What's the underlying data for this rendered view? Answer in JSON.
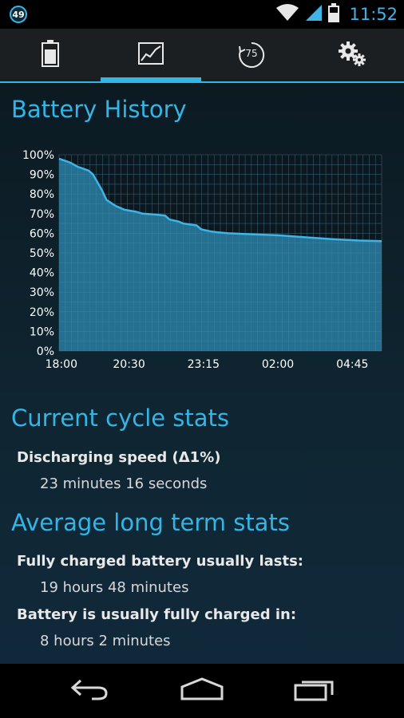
{
  "status_bar": {
    "notification_badge": "49",
    "time": "11:52",
    "icons": [
      "wifi-icon",
      "signal-icon",
      "battery-status-icon"
    ]
  },
  "tabs": [
    {
      "name": "battery",
      "icon": "battery-icon",
      "active": false
    },
    {
      "name": "history",
      "icon": "chart-icon",
      "active": true
    },
    {
      "name": "cycles",
      "icon": "cycle-counter-icon",
      "label": "75",
      "active": false
    },
    {
      "name": "settings",
      "icon": "gears-icon",
      "active": false
    }
  ],
  "history": {
    "title": "Battery History"
  },
  "current_cycle": {
    "title": "Current cycle stats",
    "discharging_label": "Discharging speed (Δ1%)",
    "discharging_value": "23 minutes 16 seconds"
  },
  "long_term": {
    "title": "Average long term stats",
    "lasts_label": "Fully charged battery usually lasts:",
    "lasts_value": "19 hours 48 minutes",
    "charged_label": "Battery is usually fully charged in:",
    "charged_value": "8 hours 2 minutes"
  },
  "nav_bar": {
    "icons": [
      "back-icon",
      "home-icon",
      "recent-apps-icon"
    ]
  },
  "colors": {
    "accent": "#33b5e5",
    "chart_fill": "#2a7fa4",
    "chart_line": "#3fb4e6"
  },
  "chart_data": {
    "type": "area",
    "title": "",
    "xlabel": "",
    "ylabel": "",
    "x_ticks": [
      "18:00",
      "20:30",
      "23:15",
      "02:00",
      "04:45"
    ],
    "y_ticks": [
      "0%",
      "10%",
      "20%",
      "30%",
      "40%",
      "50%",
      "60%",
      "70%",
      "80%",
      "90%",
      "100%"
    ],
    "ylim": [
      0,
      100
    ],
    "grid": true,
    "series": [
      {
        "points": [
          [
            "17:55",
            98
          ],
          [
            "18:20",
            96
          ],
          [
            "18:35",
            94
          ],
          [
            "19:00",
            92
          ],
          [
            "19:10",
            90
          ],
          [
            "19:30",
            82
          ],
          [
            "19:40",
            77
          ],
          [
            "20:00",
            74
          ],
          [
            "20:20",
            72
          ],
          [
            "20:45",
            71
          ],
          [
            "21:00",
            70
          ],
          [
            "21:30",
            69.5
          ],
          [
            "21:50",
            69
          ],
          [
            "22:00",
            67
          ],
          [
            "22:20",
            66
          ],
          [
            "22:30",
            65
          ],
          [
            "23:00",
            64
          ],
          [
            "23:10",
            62
          ],
          [
            "23:30",
            61
          ],
          [
            "23:45",
            60.5
          ],
          [
            "00:10",
            60
          ],
          [
            "01:00",
            59.5
          ],
          [
            "02:00",
            59
          ],
          [
            "03:00",
            58
          ],
          [
            "04:00",
            57
          ],
          [
            "05:00",
            56.3
          ],
          [
            "05:50",
            56
          ]
        ]
      }
    ]
  }
}
